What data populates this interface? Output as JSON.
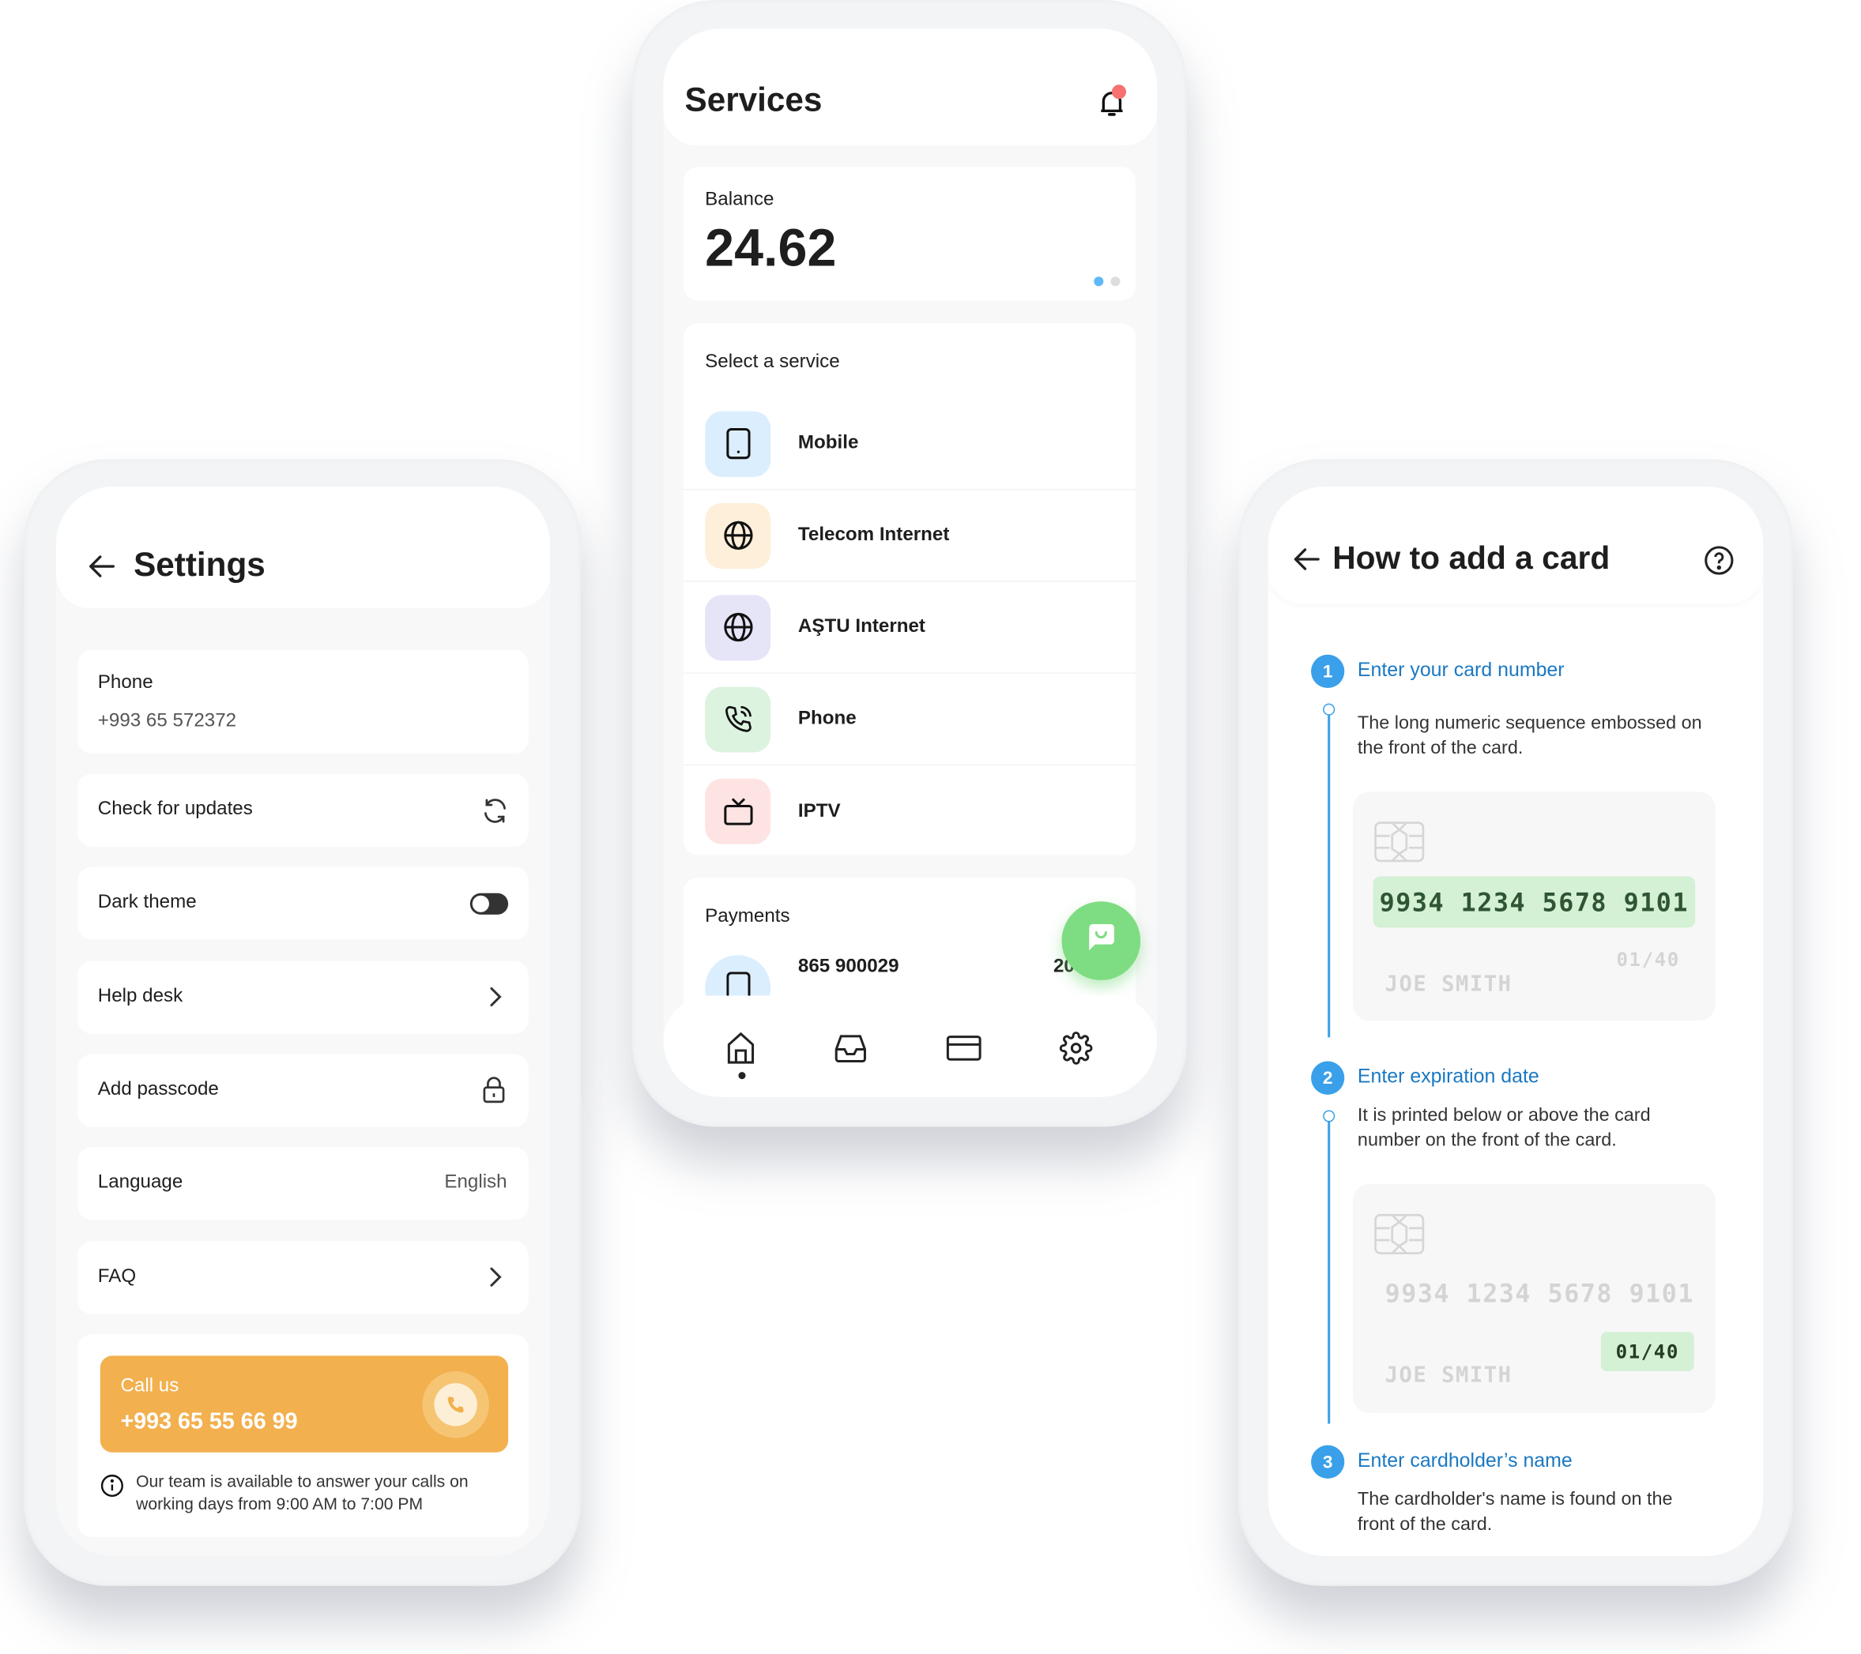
{
  "settings": {
    "title": "Settings",
    "phone_label": "Phone",
    "phone_value": "+993 65 572372",
    "items": [
      {
        "label": "Check for updates",
        "icon": "refresh-icon"
      },
      {
        "label": "Dark theme",
        "icon": "toggle",
        "toggle_on": false
      },
      {
        "label": "Help desk",
        "icon": "chevron-right-icon"
      },
      {
        "label": "Add passcode",
        "icon": "lock-icon"
      },
      {
        "label": "Language",
        "value": "English"
      },
      {
        "label": "FAQ",
        "icon": "chevron-right-icon"
      }
    ],
    "call": {
      "label": "Call us",
      "number": "+993 65 55 66 99",
      "color": "#f2b04e"
    },
    "info": "Our team is available to answer your calls on working days from 9:00 AM to 7:00 PM"
  },
  "services": {
    "title": "Services",
    "balance_label": "Balance",
    "balance_value": "24.62",
    "carousel": {
      "pages": 2,
      "active": 1
    },
    "select_label": "Select a service",
    "items": [
      {
        "label": "Mobile",
        "icon": "mobile-icon",
        "bg": "#dbeefe"
      },
      {
        "label": "Telecom Internet",
        "icon": "globe-icon",
        "bg": "#fdefd9"
      },
      {
        "label": "AŞTU Internet",
        "icon": "globe-icon",
        "bg": "#e6e4f7"
      },
      {
        "label": "Phone",
        "icon": "phone-icon",
        "bg": "#dcf3df"
      },
      {
        "label": "IPTV",
        "icon": "tv-icon",
        "bg": "#fde4e2"
      }
    ],
    "payments_label": "Payments",
    "payment": {
      "number": "865 900029",
      "amount": "20"
    },
    "nav": [
      "home-icon",
      "inbox-icon",
      "card-icon",
      "settings-icon"
    ],
    "nav_active": 0,
    "fab_color": "#7edc82"
  },
  "howto": {
    "title": "How to add a card",
    "steps": [
      {
        "n": "1",
        "title": "Enter your card number",
        "desc": "The long numeric sequence embossed on the front of the card."
      },
      {
        "n": "2",
        "title": "Enter expiration date",
        "desc": "It is printed below or above the card number on the front of the card."
      },
      {
        "n": "3",
        "title": "Enter cardholder’s name",
        "desc": "The cardholder's name is found on the front of the card."
      }
    ],
    "card": {
      "number": "9934 1234 5678 9101",
      "expiry": "01/40",
      "name": "JOE SMITH"
    },
    "accent": "#3aa0ea",
    "highlight": "#d4f0d5"
  }
}
